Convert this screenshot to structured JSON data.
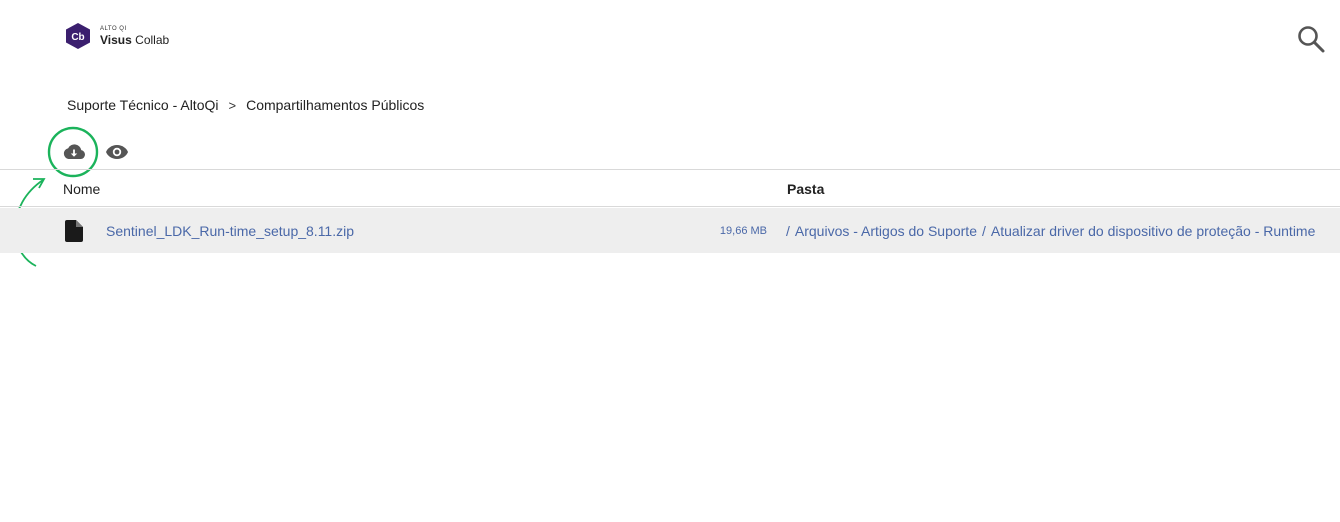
{
  "header": {
    "logo_badge": "Cb",
    "logo_small": "ALTO QI",
    "logo_brand_bold": "Visus",
    "logo_brand_light": "Collab",
    "search_icon": "search-icon"
  },
  "breadcrumb": {
    "items": [
      "Suporte Técnico - AltoQi",
      "Compartilhamentos Públicos"
    ],
    "separator": ">"
  },
  "toolbar": {
    "download_icon": "cloud-download-icon",
    "view_icon": "eye-icon"
  },
  "table": {
    "columns": [
      "Nome",
      "Pasta"
    ],
    "rows": [
      {
        "icon": "file-icon",
        "name": "Sentinel_LDK_Run-time_setup_8.11.zip",
        "size": "19,66 MB",
        "path": [
          "Arquivos - Artigos do Suporte",
          "Atualizar driver do dispositivo de proteção - Runtime"
        ]
      }
    ]
  },
  "colors": {
    "brand_purple": "#3b1f6e",
    "link_blue": "#4a68a8",
    "annotation_green": "#1bb35b",
    "row_highlight": "#eeeeee"
  }
}
